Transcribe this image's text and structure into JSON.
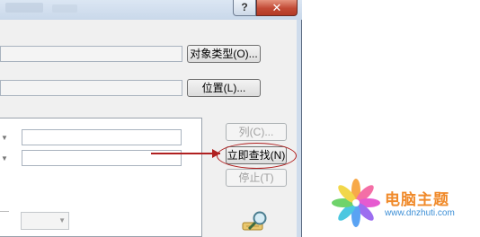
{
  "window": {
    "title": "",
    "help_label": "?",
    "close_label": "✕"
  },
  "buttons": {
    "object_types": "对象类型(O)...",
    "locations": "位置(L)...",
    "columns": "列(C)...",
    "find_now": "立即查找(N)",
    "stop": "停止(T)"
  },
  "icons": {
    "search_icon": "magnifier-search-icon",
    "watermark_logo": "pinwheel-logo"
  },
  "colors": {
    "annotation": "#b02020",
    "watermark_text": "#f08a2a",
    "watermark_url": "#3d8fd6"
  },
  "watermark": {
    "text": "电脑主题",
    "url": "www.dnzhuti.com"
  }
}
